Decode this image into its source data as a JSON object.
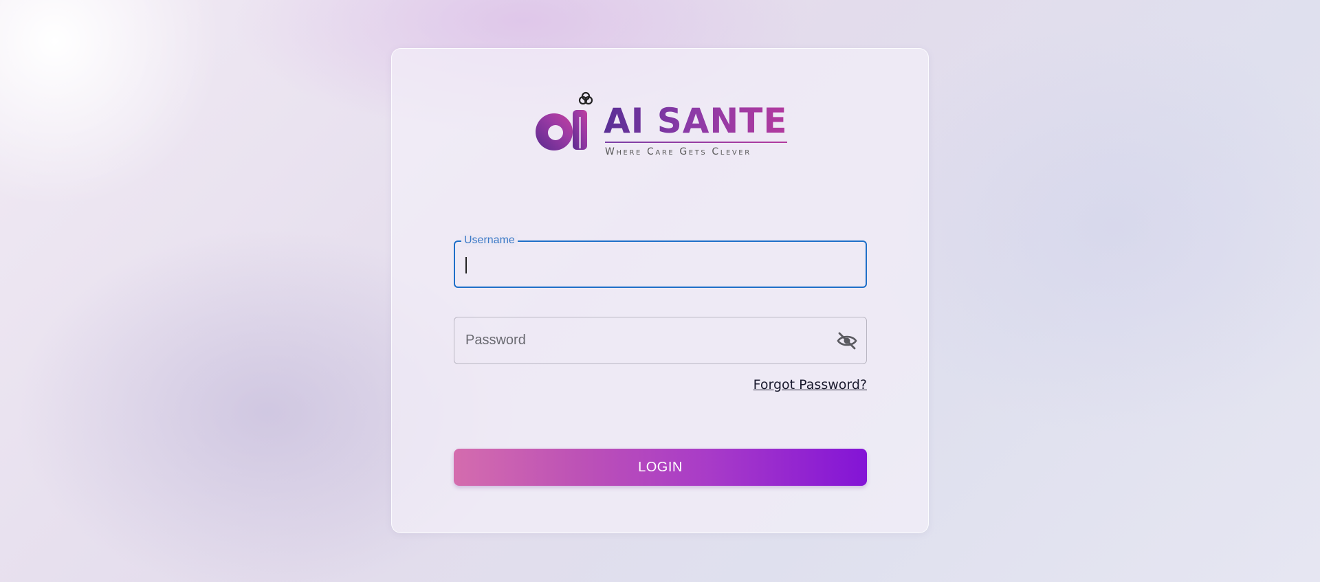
{
  "brand": {
    "name": "AI SANTE",
    "tagline": "Where Care Gets Clever",
    "mark_text": "ai",
    "colors": {
      "purple": "#5a2f95",
      "magenta": "#b23a9e"
    }
  },
  "login_form": {
    "username": {
      "label": "Username",
      "value": "",
      "focused": true
    },
    "password": {
      "placeholder": "Password",
      "value": "",
      "visibility_icon": "eye-off-icon"
    },
    "forgot_password_label": "Forgot Password?",
    "login_label": "LOGIN"
  },
  "colors": {
    "focus_border": "#1e6fc8",
    "login_gradient_start": "#d46cae",
    "login_gradient_end": "#8314d6"
  }
}
